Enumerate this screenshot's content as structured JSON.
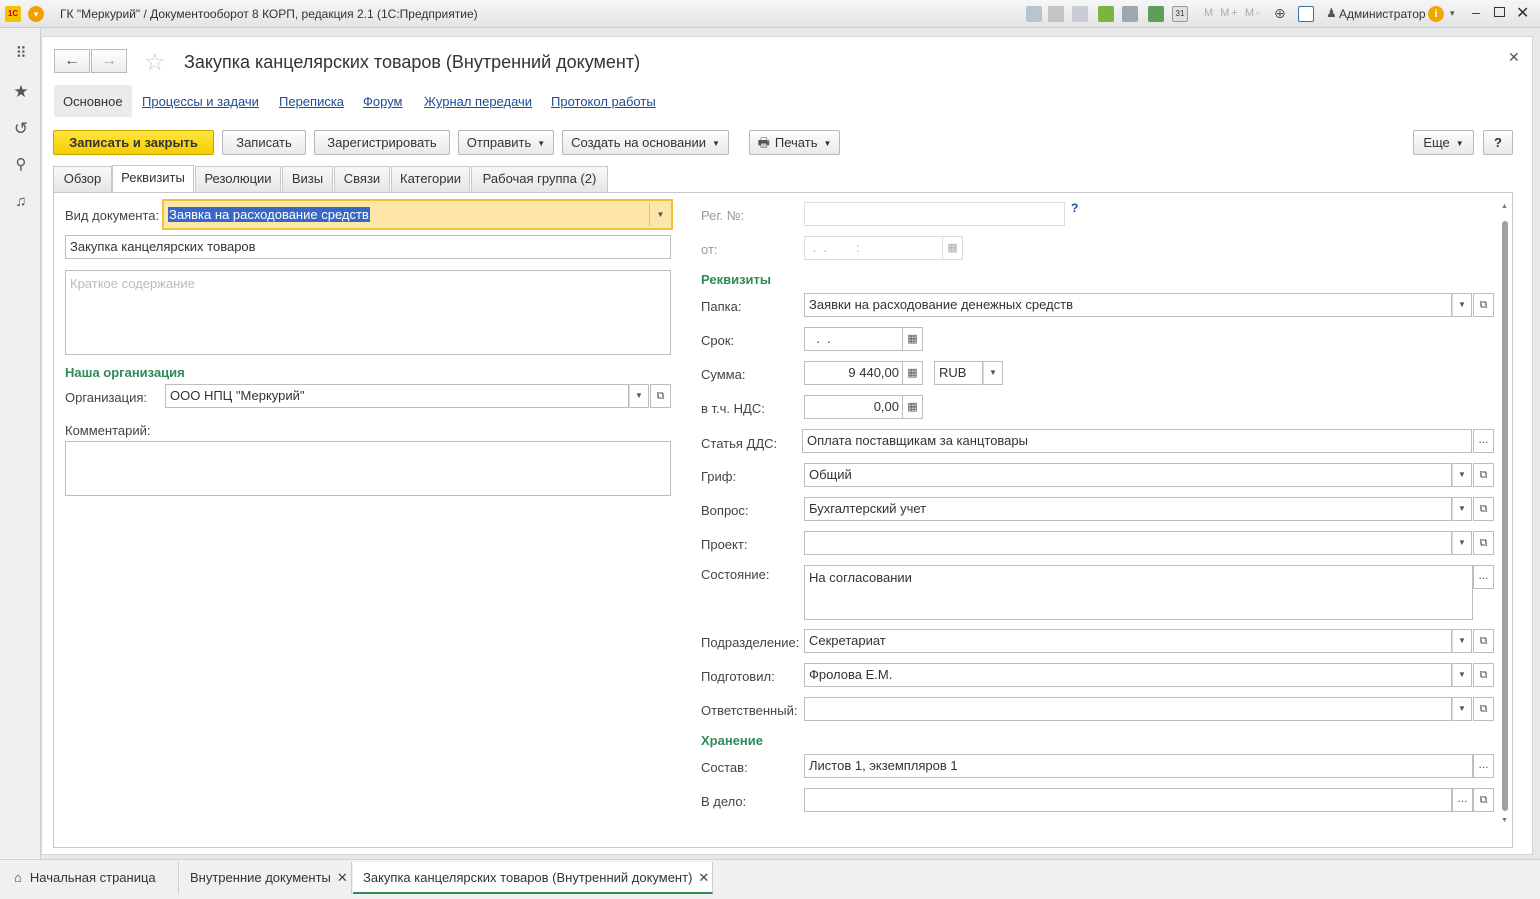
{
  "titlebar": {
    "title": "ГК \"Меркурий\" / Документооборот 8 КОРП, редакция 2.1  (1С:Предприятие)",
    "m_buttons": [
      "M",
      "M+",
      "M-"
    ],
    "user": "Администратор"
  },
  "document": {
    "title": "Закупка канцелярских товаров (Внутренний документ)"
  },
  "nav_links": {
    "main": "Основное",
    "processes": "Процессы и задачи",
    "correspondence": "Переписка",
    "forum": "Форум",
    "transfer_log": "Журнал передачи",
    "work_log": "Протокол работы"
  },
  "toolbar": {
    "save_close": "Записать и закрыть",
    "save": "Записать",
    "register": "Зарегистрировать",
    "send": "Отправить",
    "create_based": "Создать на основании",
    "print": "Печать",
    "more": "Еще",
    "help": "?"
  },
  "tabs": [
    "Обзор",
    "Реквизиты",
    "Резолюции",
    "Визы",
    "Связи",
    "Категории",
    "Рабочая группа (2)"
  ],
  "left": {
    "doc_type_label": "Вид документа:",
    "doc_type_value": "Заявка на расходование средств",
    "title_value": "Закупка канцелярских товаров",
    "summary_placeholder": "Краткое содержание",
    "org_group": "Наша организация",
    "org_label": "Организация:",
    "org_value": "ООО НПЦ \"Меркурий\"",
    "comment_label": "Комментарий:"
  },
  "right": {
    "reg_label": "Рег. №:",
    "reg_help": "?",
    "from_label": "от:",
    "from_value": " .  .        :   ",
    "props_group": "Реквизиты",
    "folder_label": "Папка:",
    "folder_value": "Заявки на расходование денежных средств",
    "due_label": "Срок:",
    "due_value": "  .  .",
    "sum_label": "Сумма:",
    "sum_value": "9 440,00",
    "currency": "RUB",
    "vat_label": "в т.ч. НДС:",
    "vat_value": "0,00",
    "dds_label": "Статья ДДС:",
    "dds_value": "Оплата поставщикам за канцтовары",
    "grif_label": "Гриф:",
    "grif_value": "Общий",
    "question_label": "Вопрос:",
    "question_value": "Бухгалтерский учет",
    "project_label": "Проект:",
    "state_label": "Состояние:",
    "state_value": "На согласовании",
    "dept_label": "Подразделение:",
    "dept_value": "Секретариат",
    "prepared_label": "Подготовил:",
    "prepared_value": "Фролова Е.М.",
    "responsible_label": "Ответственный:",
    "storage_group": "Хранение",
    "composition_label": "Состав:",
    "composition_value": "Листов 1, экземпляров 1",
    "file_label": "В дело:"
  },
  "bottom_tabs": {
    "home": "Начальная страница",
    "internal_docs": "Внутренние документы",
    "current": "Закупка канцелярских товаров (Внутренний документ)"
  },
  "colors": {
    "accent_green": "#2e8b57",
    "primary_yellow": "#f5cc00",
    "link_blue": "#1a4e99"
  }
}
